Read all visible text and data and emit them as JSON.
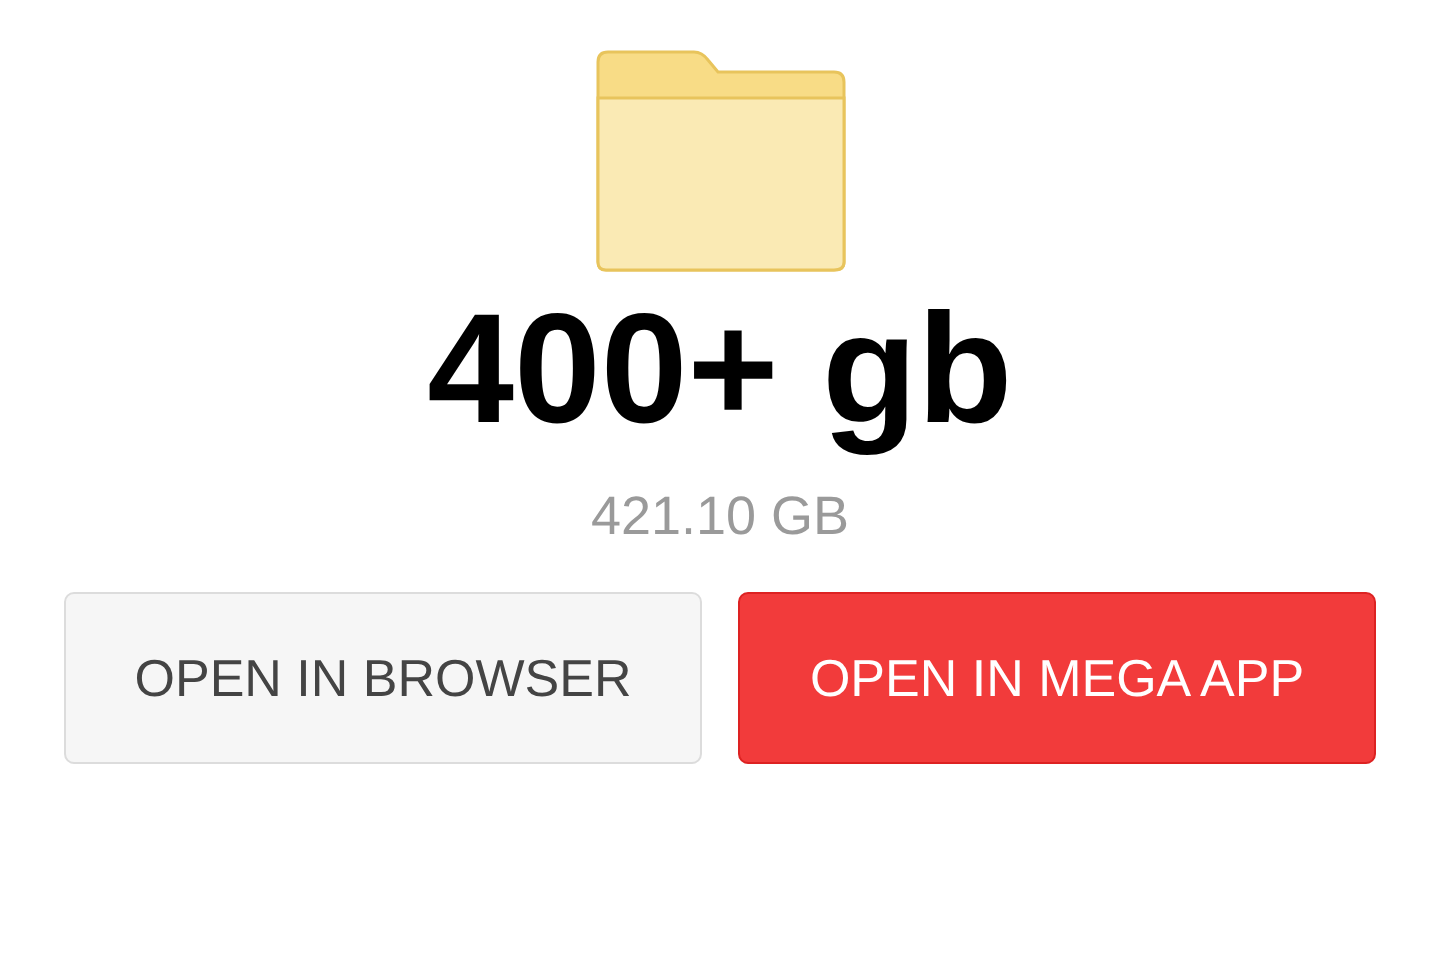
{
  "folder": {
    "name": "400+ gb",
    "size": "421.10 GB"
  },
  "buttons": [
    {
      "label": "OPEN IN BROWSER",
      "kind": "secondary"
    },
    {
      "label": "OPEN IN MEGA APP",
      "kind": "primary"
    }
  ]
}
